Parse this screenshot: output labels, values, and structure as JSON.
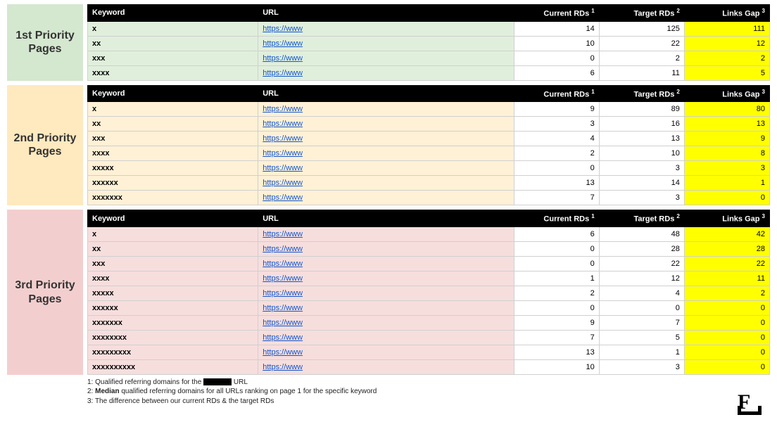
{
  "headers": {
    "keyword": "Keyword",
    "url": "URL",
    "current": "Current RDs",
    "current_sup": "1",
    "target": "Target RDs",
    "target_sup": "2",
    "gap": "Links Gap",
    "gap_sup": "3"
  },
  "sections": [
    {
      "label": "1st Priority Pages",
      "class": "sec1",
      "side": "side-1",
      "rows": [
        {
          "kw": "x",
          "url": "https://www",
          "current": 14,
          "target": 125,
          "gap": 111
        },
        {
          "kw": "xx",
          "url": "https://www",
          "current": 10,
          "target": 22,
          "gap": 12
        },
        {
          "kw": "xxx",
          "url": "https://www",
          "current": 0,
          "target": 2,
          "gap": 2
        },
        {
          "kw": "xxxx",
          "url": "https://www",
          "current": 6,
          "target": 11,
          "gap": 5
        }
      ]
    },
    {
      "label": "2nd Priority Pages",
      "class": "sec2",
      "side": "side-2",
      "rows": [
        {
          "kw": "x",
          "url": "https://www",
          "current": 9,
          "target": 89,
          "gap": 80
        },
        {
          "kw": "xx",
          "url": "https://www",
          "current": 3,
          "target": 16,
          "gap": 13
        },
        {
          "kw": "xxx",
          "url": "https://www",
          "current": 4,
          "target": 13,
          "gap": 9
        },
        {
          "kw": "xxxx",
          "url": "https://www",
          "current": 2,
          "target": 10,
          "gap": 8
        },
        {
          "kw": "xxxxx",
          "url": "https://www",
          "current": 0,
          "target": 3,
          "gap": 3
        },
        {
          "kw": "xxxxxx",
          "url": "https://www",
          "current": 13,
          "target": 14,
          "gap": 1
        },
        {
          "kw": "xxxxxxx",
          "url": "https://www",
          "current": 7,
          "target": 3,
          "gap": 0
        }
      ]
    },
    {
      "label": "3rd Priority Pages",
      "class": "sec3",
      "side": "side-3",
      "rows": [
        {
          "kw": "x",
          "url": "https://www",
          "current": 6,
          "target": 48,
          "gap": 42
        },
        {
          "kw": "xx",
          "url": "https://www",
          "current": 0,
          "target": 28,
          "gap": 28
        },
        {
          "kw": "xxx",
          "url": "https://www",
          "current": 0,
          "target": 22,
          "gap": 22
        },
        {
          "kw": "xxxx",
          "url": "https://www",
          "current": 1,
          "target": 12,
          "gap": 11
        },
        {
          "kw": "xxxxx",
          "url": "https://www",
          "current": 2,
          "target": 4,
          "gap": 2
        },
        {
          "kw": "xxxxxx",
          "url": "https://www",
          "current": 0,
          "target": 0,
          "gap": 0
        },
        {
          "kw": "xxxxxxx",
          "url": "https://www",
          "current": 9,
          "target": 7,
          "gap": 0
        },
        {
          "kw": "xxxxxxxx",
          "url": "https://www",
          "current": 7,
          "target": 5,
          "gap": 0
        },
        {
          "kw": "xxxxxxxxx",
          "url": "https://www",
          "current": 13,
          "target": 1,
          "gap": 0
        },
        {
          "kw": "xxxxxxxxxx",
          "url": "https://www",
          "current": 10,
          "target": 3,
          "gap": 0
        }
      ]
    }
  ],
  "footnotes": {
    "f1_pre": "1: Qualified referring domains for the ",
    "f1_post": " URL",
    "f2_pre": "2: ",
    "f2_bold": "Median",
    "f2_post": " qualified referring domains for all URLs ranking on page 1 for the specific keyword",
    "f3": "3: The difference between our current RDs & the target RDs"
  },
  "logo": "F"
}
